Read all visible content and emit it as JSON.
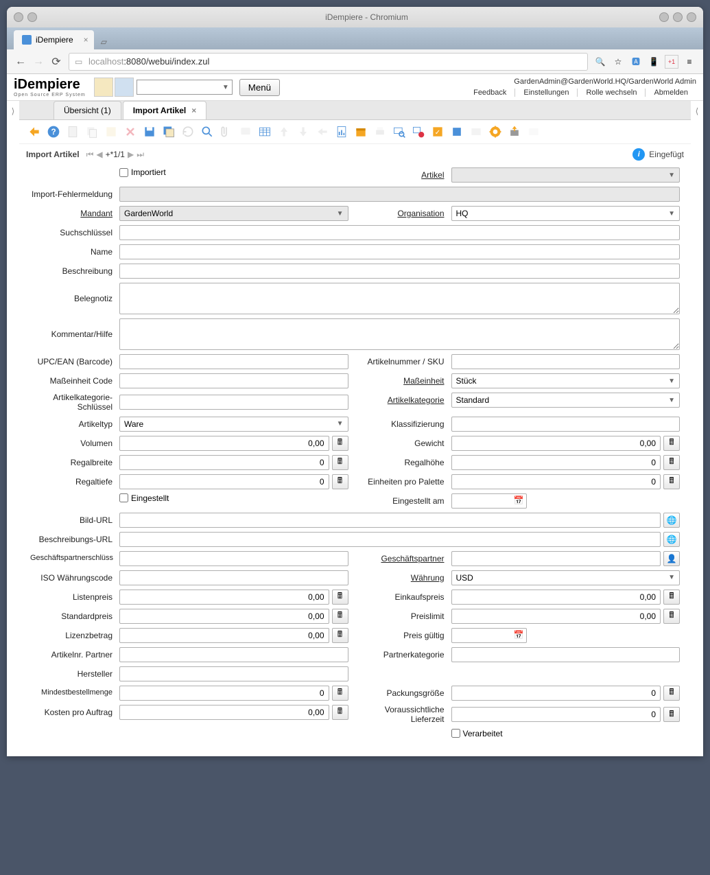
{
  "window": {
    "title": "iDempiere - Chromium"
  },
  "browser": {
    "tab_title": "iDempiere",
    "url_host": "localhost",
    "url_path": ":8080/webui/index.zul"
  },
  "app": {
    "logo": "iDempiere",
    "logo_sub": "Open Source ERP System",
    "menu_btn": "Menü",
    "user_info": "GardenAdmin@GardenWorld.HQ/GardenWorld Admin",
    "links": {
      "feedback": "Feedback",
      "settings": "Einstellungen",
      "role": "Rolle wechseln",
      "logout": "Abmelden"
    }
  },
  "tabs": {
    "overview": "Übersicht (1)",
    "active": "Import Artikel"
  },
  "subheader": {
    "title": "Import Artikel",
    "page_indicator": "+*1/1",
    "status": "Eingefügt"
  },
  "form": {
    "importiert_lbl": "Importiert",
    "artikel_lbl": "Artikel",
    "artikel_val": "",
    "import_fehler_lbl": "Import-Fehlermeldung",
    "import_fehler_val": "",
    "mandant_lbl": "Mandant",
    "mandant_val": "GardenWorld",
    "organisation_lbl": "Organisation",
    "organisation_val": "HQ",
    "suchschluessel_lbl": "Suchschlüssel",
    "suchschluessel_val": "",
    "name_lbl": "Name",
    "name_val": "",
    "beschreibung_lbl": "Beschreibung",
    "beschreibung_val": "",
    "belegnotiz_lbl": "Belegnotiz",
    "belegnotiz_val": "",
    "kommentar_lbl": "Kommentar/Hilfe",
    "kommentar_val": "",
    "upc_lbl": "UPC/EAN (Barcode)",
    "upc_val": "",
    "sku_lbl": "Artikelnummer / SKU",
    "sku_val": "",
    "masseinheit_code_lbl": "Maßeinheit Code",
    "masseinheit_code_val": "",
    "masseinheit_lbl": "Maßeinheit",
    "masseinheit_val": "Stück",
    "artikelkategorie_schl_lbl": "Artikelkategorie-Schlüssel",
    "artikelkategorie_schl_val": "",
    "artikelkategorie_lbl": "Artikelkategorie",
    "artikelkategorie_val": "Standard",
    "artikeltyp_lbl": "Artikeltyp",
    "artikeltyp_val": "Ware",
    "klassifizierung_lbl": "Klassifizierung",
    "klassifizierung_val": "",
    "volumen_lbl": "Volumen",
    "volumen_val": "0,00",
    "gewicht_lbl": "Gewicht",
    "gewicht_val": "0,00",
    "regalbreite_lbl": "Regalbreite",
    "regalbreite_val": "0",
    "regalhoehe_lbl": "Regalhöhe",
    "regalhoehe_val": "0",
    "regaltiefe_lbl": "Regaltiefe",
    "regaltiefe_val": "0",
    "einheiten_palette_lbl": "Einheiten pro Palette",
    "einheiten_palette_val": "0",
    "eingestellt_lbl": "Eingestellt",
    "eingestellt_am_lbl": "Eingestellt am",
    "eingestellt_am_val": "",
    "bild_url_lbl": "Bild-URL",
    "bild_url_val": "",
    "beschreibungs_url_lbl": "Beschreibungs-URL",
    "beschreibungs_url_val": "",
    "gp_schluessel_lbl": "Geschäftspartnerschlüss",
    "gp_schluessel_val": "",
    "gp_lbl": "Geschäftspartner",
    "gp_val": "",
    "iso_waehrung_lbl": "ISO Währungscode",
    "iso_waehrung_val": "",
    "waehrung_lbl": "Währung",
    "waehrung_val": "USD",
    "listenpreis_lbl": "Listenpreis",
    "listenpreis_val": "0,00",
    "einkaufspreis_lbl": "Einkaufspreis",
    "einkaufspreis_val": "0,00",
    "standardpreis_lbl": "Standardpreis",
    "standardpreis_val": "0,00",
    "preislimit_lbl": "Preislimit",
    "preislimit_val": "0,00",
    "lizenzbetrag_lbl": "Lizenzbetrag",
    "lizenzbetrag_val": "0,00",
    "preis_gueltig_lbl": "Preis gültig",
    "preis_gueltig_val": "",
    "artikelnr_partner_lbl": "Artikelnr. Partner",
    "artikelnr_partner_val": "",
    "partnerkategorie_lbl": "Partnerkategorie",
    "partnerkategorie_val": "",
    "hersteller_lbl": "Hersteller",
    "hersteller_val": "",
    "mindestbestellmenge_lbl": "Mindestbestellmenge",
    "mindestbestellmenge_val": "0",
    "packungsgroesse_lbl": "Packungsgröße",
    "packungsgroesse_val": "0",
    "kosten_auftrag_lbl": "Kosten pro Auftrag",
    "kosten_auftrag_val": "0,00",
    "lieferzeit_lbl": "Voraussichtliche Lieferzeit",
    "lieferzeit_val": "0",
    "verarbeitet_lbl": "Verarbeitet"
  }
}
